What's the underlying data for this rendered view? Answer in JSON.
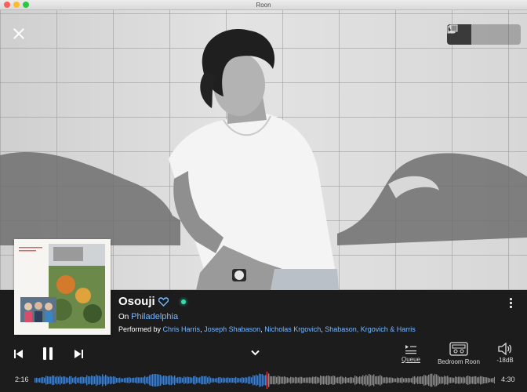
{
  "window": {
    "title": "Roon"
  },
  "now_playing": {
    "track": "Osouji",
    "album_prefix": "On",
    "album": "Philadelphia",
    "performed_by_prefix": "Performed by",
    "artists": [
      "Chris Harris",
      "Joseph Shabason",
      "Nicholas Krgovich",
      "Shabason, Krgovich & Harris"
    ],
    "separator": ","
  },
  "transport": {
    "elapsed": "2:16",
    "duration": "4:30",
    "progress_fraction": 0.5037
  },
  "zone": {
    "queue_label": "Queue",
    "room_label": "Bedroom Roon",
    "volume_label": "-18dB"
  },
  "colors": {
    "accent": "#7ab8ff",
    "played_wave": "#4a7fbf",
    "unplayed_wave": "#8a8a8a",
    "playhead": "#e0303a",
    "signal_dot": "#33e0b0"
  },
  "icons": [
    "close-icon",
    "artist-view-icon",
    "disc-view-icon",
    "album-stack-icon",
    "heart-icon",
    "more-icon",
    "previous-icon",
    "pause-icon",
    "next-icon",
    "chevron-down-icon",
    "queue-icon",
    "speaker-icon",
    "volume-icon"
  ]
}
